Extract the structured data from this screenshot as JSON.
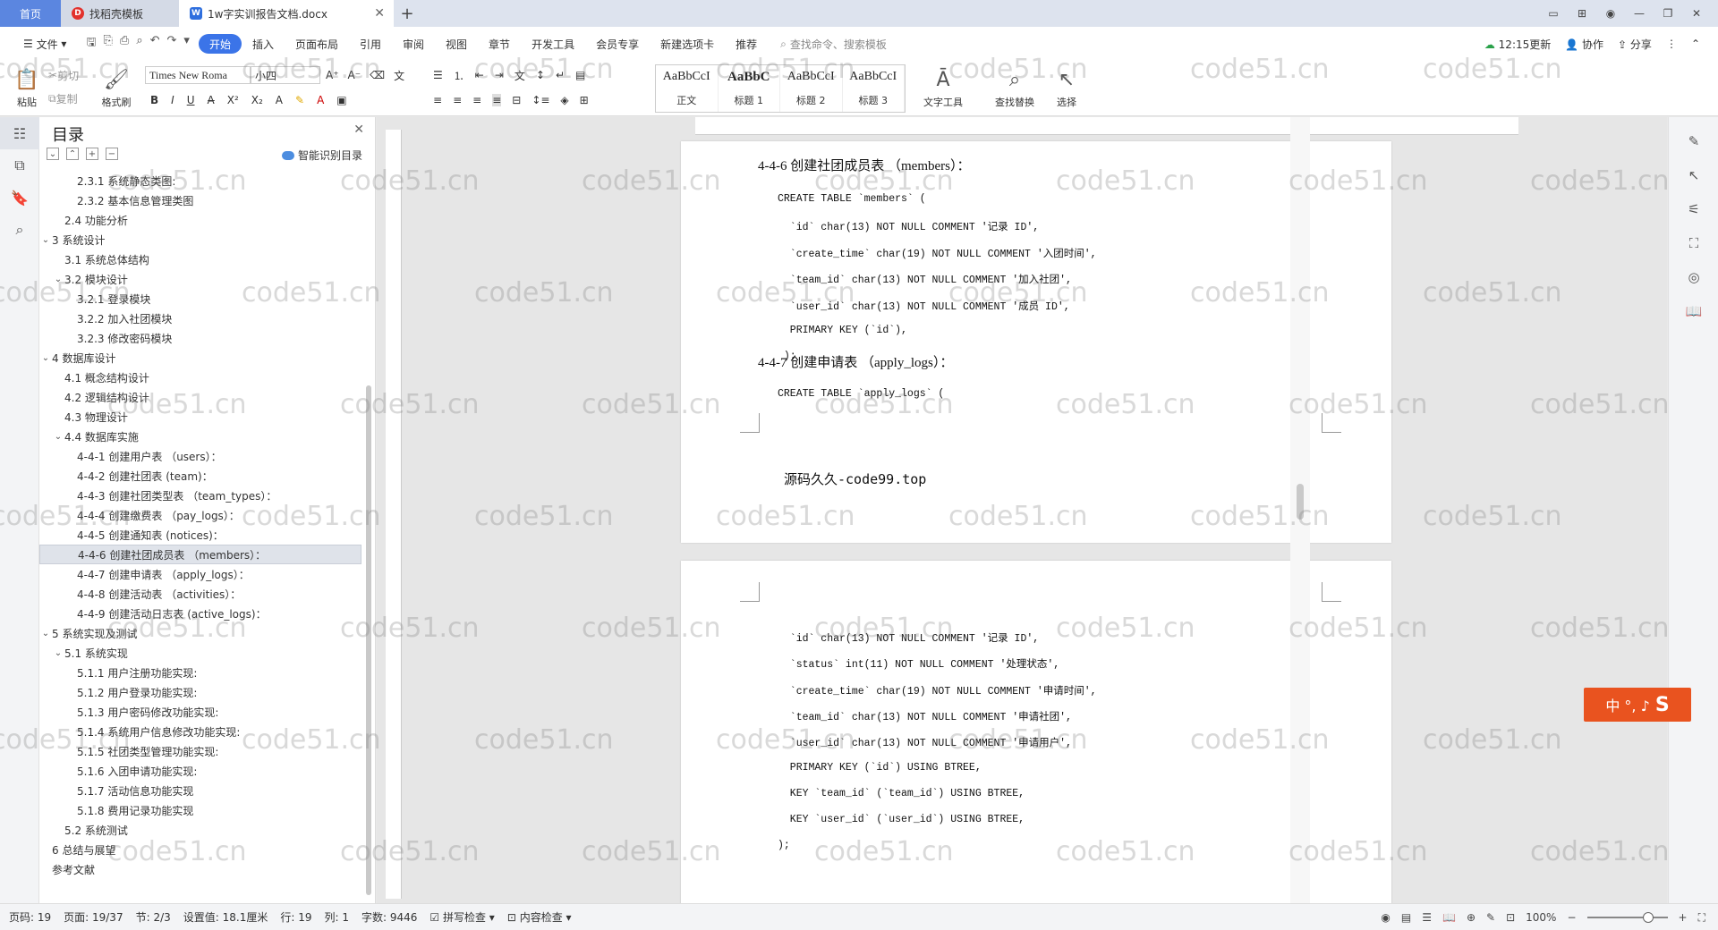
{
  "tabs": {
    "home": "首页",
    "templates": "找稻壳模板",
    "document": "1w字实训报告文档.docx"
  },
  "menu": {
    "file": "文件",
    "items": [
      "开始",
      "插入",
      "页面布局",
      "引用",
      "审阅",
      "视图",
      "章节",
      "开发工具",
      "会员专享",
      "新建选项卡",
      "推荐"
    ],
    "active_index": 0,
    "search_placeholder": "查找命令、搜索模板",
    "sync": "12:15更新",
    "collab": "协作",
    "share": "分享"
  },
  "ribbon": {
    "paste": "粘贴",
    "cut": "剪切",
    "copy": "复制",
    "format_painter": "格式刷",
    "font_name": "Times New Roma",
    "font_size": "小四",
    "styles": [
      {
        "sample": "AaBbCcI",
        "name": "正文"
      },
      {
        "sample": "AaBbC",
        "name": "标题 1"
      },
      {
        "sample": "AaBbCcI",
        "name": "标题 2"
      },
      {
        "sample": "AaBbCcI",
        "name": "标题 3"
      }
    ],
    "text_tools": "文字工具",
    "find_replace": "查找替换",
    "select": "选择"
  },
  "toc": {
    "title": "目录",
    "smart": "智能识别目录",
    "items": [
      {
        "label": "2.3.1 系统静态类图:",
        "level": 3
      },
      {
        "label": "2.3.2 基本信息管理类图",
        "level": 3
      },
      {
        "label": "2.4 功能分析",
        "level": 2
      },
      {
        "label": "3 系统设计",
        "level": 1,
        "arrow": "v"
      },
      {
        "label": "3.1 系统总体结构",
        "level": 2
      },
      {
        "label": "3.2 模块设计",
        "level": 2,
        "arrow": "v"
      },
      {
        "label": "3.2.1 登录模块",
        "level": 3
      },
      {
        "label": "3.2.2 加入社团模块",
        "level": 3
      },
      {
        "label": "3.2.3 修改密码模块",
        "level": 3
      },
      {
        "label": "4 数据库设计",
        "level": 1,
        "arrow": "v"
      },
      {
        "label": "4.1 概念结构设计",
        "level": 2
      },
      {
        "label": "4.2 逻辑结构设计",
        "level": 2
      },
      {
        "label": "4.3 物理设计",
        "level": 2
      },
      {
        "label": "4.4 数据库实施",
        "level": 2,
        "arrow": "v"
      },
      {
        "label": "4-4-1 创建用户表 （users）：",
        "level": 3
      },
      {
        "label": "4-4-2 创建社团表 (team)：",
        "level": 3
      },
      {
        "label": "4-4-3 创建社团类型表 （team_types）：",
        "level": 3
      },
      {
        "label": "4-4-4 创建缴费表 （pay_logs）：",
        "level": 3
      },
      {
        "label": "4-4-5 创建通知表 (notices)：",
        "level": 3
      },
      {
        "label": "4-4-6 创建社团成员表 （members）：",
        "level": 3,
        "selected": true
      },
      {
        "label": "4-4-7 创建申请表 （apply_logs）：",
        "level": 3
      },
      {
        "label": "4-4-8 创建活动表 （activities）：",
        "level": 3
      },
      {
        "label": "4-4-9 创建活动日志表 (active_logs)：",
        "level": 3
      },
      {
        "label": "5 系统实现及测试",
        "level": 1,
        "arrow": "v"
      },
      {
        "label": "5.1 系统实现",
        "level": 2,
        "arrow": "v"
      },
      {
        "label": "5.1.1 用户注册功能实现:",
        "level": 3
      },
      {
        "label": "5.1.2 用户登录功能实现:",
        "level": 3
      },
      {
        "label": "5.1.3 用户密码修改功能实现:",
        "level": 3
      },
      {
        "label": "5.1.4 系统用户信息修改功能实现:",
        "level": 3
      },
      {
        "label": "5.1.5 社团类型管理功能实现:",
        "level": 3
      },
      {
        "label": "5.1.6 入团申请功能实现:",
        "level": 3
      },
      {
        "label": "5.1.7 活动信息功能实现",
        "level": 3
      },
      {
        "label": "5.1.8 费用记录功能实现",
        "level": 3
      },
      {
        "label": "5.2 系统测试",
        "level": 2
      },
      {
        "label": "6 总结与展望",
        "level": 1
      },
      {
        "label": "参考文献",
        "level": 1
      }
    ]
  },
  "document": {
    "page1": {
      "heading1": "4-4-6 创建社团成员表 （members）：",
      "code1": [
        "CREATE TABLE `members` (",
        "  `id` char(13) NOT NULL COMMENT '记录 ID',",
        "  `create_time` char(19) NOT NULL COMMENT '入团时间',",
        "  `team_id` char(13) NOT NULL COMMENT '加入社团',",
        "  `user_id` char(13) NOT NULL COMMENT '成员 ID',",
        "  PRIMARY KEY (`id`),",
        " );"
      ],
      "heading2": "4-4-7 创建申请表 （apply_logs）：",
      "code2": "CREATE TABLE `apply_logs` (",
      "footer": "源码久久-code99.top"
    },
    "page2": {
      "code": [
        "  `id` char(13) NOT NULL COMMENT '记录 ID',",
        "  `status` int(11) NOT NULL COMMENT '处理状态',",
        "  `create_time` char(19) NOT NULL COMMENT '申请时间',",
        "  `team_id` char(13) NOT NULL COMMENT '申请社团',",
        "  `user_id` char(13) NOT NULL COMMENT '申请用户',",
        "  PRIMARY KEY (`id`) USING BTREE,",
        "  KEY `team_id` (`team_id`) USING BTREE,",
        "  KEY `user_id` (`user_id`) USING BTREE,",
        ");"
      ]
    }
  },
  "ime": "中 °, ♪",
  "watermark": "code51.cn",
  "status": {
    "page_num": "页码: 19",
    "page": "页面: 19/37",
    "section": "节: 2/3",
    "setting": "设置值: 18.1厘米",
    "row": "行: 19",
    "col": "列: 1",
    "word_count": "字数: 9446",
    "spell": "拼写检查",
    "content_check": "内容检查",
    "zoom": "100%"
  }
}
